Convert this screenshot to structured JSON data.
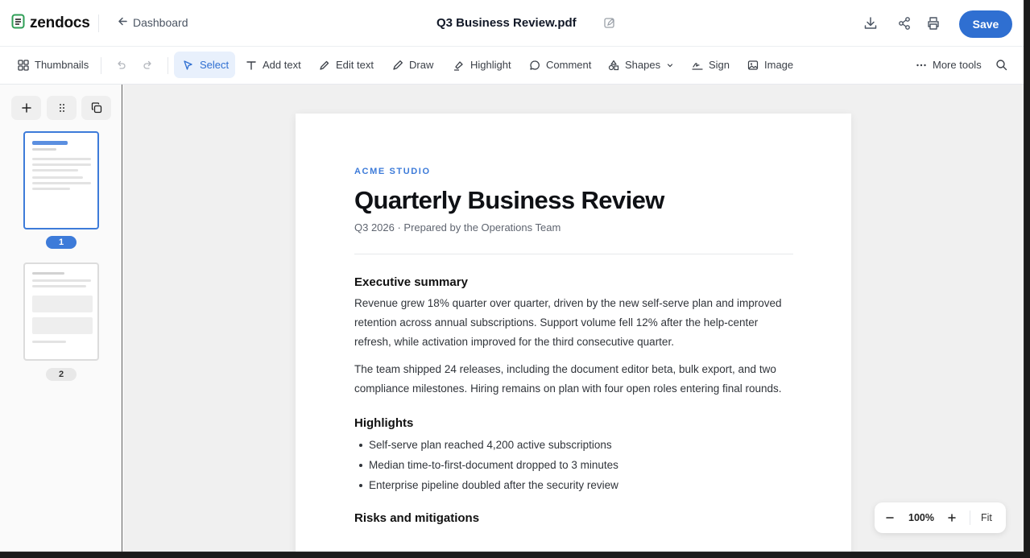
{
  "app": {
    "brand": "zendocs",
    "back_label": "Dashboard",
    "document_title": "Q3 Business Review.pdf",
    "save_label": "Save"
  },
  "toolbar": {
    "thumbnails": "Thumbnails",
    "select": "Select",
    "add_text": "Add text",
    "edit_text": "Edit text",
    "draw": "Draw",
    "highlight": "Highlight",
    "comment": "Comment",
    "shapes": "Shapes",
    "sign": "Sign",
    "image": "Image",
    "more_tools": "More tools"
  },
  "pages": [
    {
      "number": "1",
      "selected": true
    },
    {
      "number": "2",
      "selected": false
    }
  ],
  "document": {
    "org": "ACME STUDIO",
    "title": "Quarterly Business Review",
    "subtitle": "Q3 2026 · Prepared by the Operations Team",
    "exec_heading": "Executive summary",
    "exec_p1": "Revenue grew 18% quarter over quarter, driven by the new self-serve plan and improved retention across annual subscriptions. Support volume fell 12% after the help-center refresh, while activation improved for the third consecutive quarter.",
    "exec_p2": "The team shipped 24 releases, including the document editor beta, bulk export, and two compliance milestones. Hiring remains on plan with four open roles entering final rounds.",
    "highlights_heading": "Highlights",
    "highlights": [
      "Self-serve plan reached 4,200 active subscriptions",
      "Median time-to-first-document dropped to 3 minutes",
      "Enterprise pipeline doubled after the security review"
    ],
    "risks_heading": "Risks and mitigations"
  },
  "zoom": {
    "level": "100%",
    "fit_label": "Fit"
  },
  "colors": {
    "accent": "#2f6fd1",
    "brand_green": "#2e9e55"
  }
}
